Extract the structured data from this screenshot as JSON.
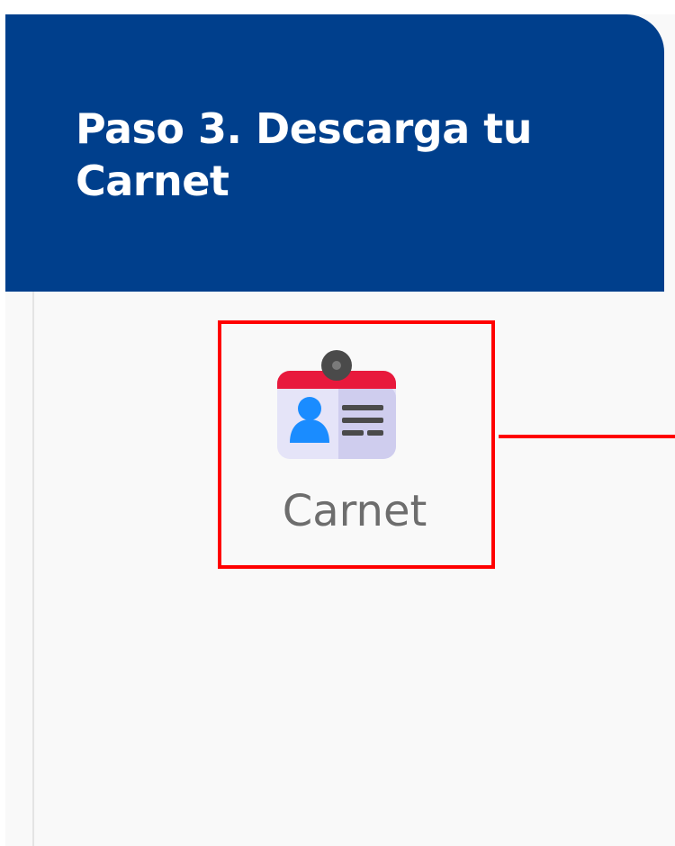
{
  "header": {
    "title": "Paso 3. Descarga tu Carnet"
  },
  "carnet_option": {
    "label": "Carnet",
    "icon": "id-badge-icon"
  },
  "colors": {
    "header_background": "#003f8c",
    "highlight": "#ff0000",
    "panel_background": "#f9f9f9",
    "label_text": "#6d6d6d"
  }
}
